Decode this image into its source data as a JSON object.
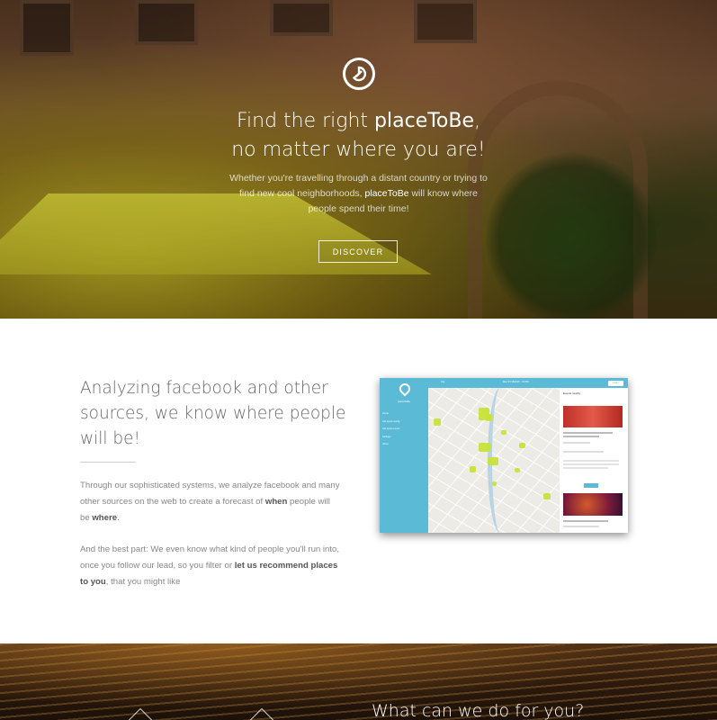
{
  "hero": {
    "title_prefix": "Find the right ",
    "title_brand": "placeToBe",
    "title_suffix": ",",
    "title_line2": "no matter where you are!",
    "subtitle_part1": "Whether you're travelling through a distant country or trying to find new cool neighborhoods, ",
    "subtitle_brand": "placeToBe",
    "subtitle_part2": " will know where people spend their time!",
    "discover_label": "DISCOVER"
  },
  "about": {
    "heading": "Analyzing facebook and other sources, we know where people will be!",
    "para1_part1": "Through our sophisticated systems, we analyze facebook and many other sources on the web to create a forecast of ",
    "para1_when": "when",
    "para1_part2": " people will be ",
    "para1_where": "where",
    "para1_end": ".",
    "para2_part1": "And the best part: We even know what kind of people you'll run into, once you follow our lead, so you filter or ",
    "para2_bold": "let us recommend places to you",
    "para2_end": ", that you might like"
  },
  "app_mock": {
    "brand": "placeToBe",
    "nav": [
      "Home",
      "Hot spots nearby",
      "Hot spots events",
      "Settings",
      "About"
    ],
    "top_city": "City",
    "top_date": "Mon 07/18/2015 · 10 PM",
    "top_button": "Login",
    "panel_title": "Events nearby",
    "event1": "TRAUM Sommernacht 2015 in Edusteo",
    "event2": "NIGHT ON THE BLACK MADONNA"
  },
  "bottom": {
    "title": "What can we do for you?"
  },
  "colors": {
    "accent_blue": "#5bbad6",
    "hot_spot": "#c8e33a"
  }
}
